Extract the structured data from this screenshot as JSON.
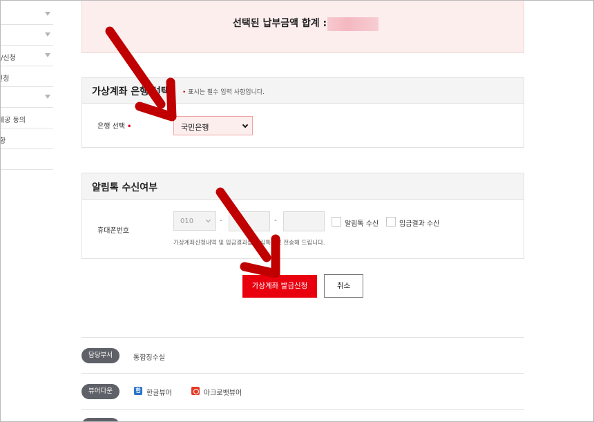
{
  "sidebar": {
    "items": [
      {
        "label": ""
      },
      {
        "label": ""
      },
      {
        "label": "/신청"
      },
      {
        "label": "신청"
      },
      {
        "label": ""
      },
      {
        "label": "제공 동의"
      },
      {
        "label": "항"
      }
    ]
  },
  "summary": {
    "total_label": "선택된 납부금액 합계 :"
  },
  "bank_section": {
    "title": "가상계좌 은행 선택",
    "required_note_symbol": "•",
    "required_note": "표시는 필수 입력 사항입니다.",
    "bank_label": "은행 선택",
    "bank_selected": "국민은행"
  },
  "alimtalk_section": {
    "title": "알림톡 수신여부",
    "phone_label": "휴대폰번호",
    "phone_prefix": "010",
    "phone_dash": "-",
    "opt_alimtalk": "알림톡 수신",
    "opt_deposit_result": "입금결과 수신",
    "helper_text": "가상계좌신청내역 및 입금결과를 알림톡으로 전송해 드립니다."
  },
  "actions": {
    "apply": "가상계좌 발급신청",
    "cancel": "취소"
  },
  "footer": {
    "dept_tag": "담당부서",
    "dept_name": "통합징수실",
    "viewer_tag": "뷰어다운",
    "hwp_icon_letter": "한",
    "hwp_viewer": "한글뷰어",
    "acrobat_viewer": "아크로뱃뷰어"
  },
  "colors": {
    "accent_red": "#e8000f",
    "summary_bg": "#fdeeee",
    "annotation_arrow": "#c00000"
  },
  "icons": {
    "sidebar_caret": "caret-down-icon",
    "select_chevron": "chevron-down-icon",
    "hwp": "hwp-viewer-icon",
    "pdf": "acrobat-pdf-icon",
    "annotation": "red-arrow-annotation"
  }
}
